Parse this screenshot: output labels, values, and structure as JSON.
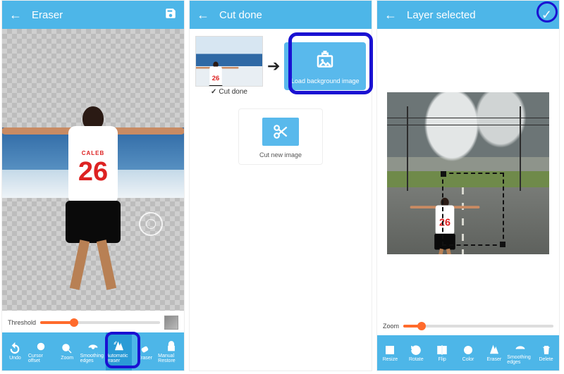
{
  "screen1": {
    "title": "Eraser",
    "threshold_label": "Threshold",
    "jersey_name": "CALEB",
    "jersey_number": "26",
    "tools": {
      "undo": "Undo",
      "cursor_offset": "Cursor offset",
      "zoom": "Zoom",
      "smoothing_edges": "Smoothing edges",
      "automatic_eraser": "Automatic eraser",
      "eraser": "Eraser",
      "manual_restore": "Manual Restore"
    }
  },
  "screen2": {
    "title": "Cut done",
    "cut_done": "Cut done",
    "load_bg": "Load background image",
    "cut_new": "Cut new image"
  },
  "screen3": {
    "title": "Layer selected",
    "zoom_label": "Zoom",
    "jersey_number": "26",
    "tools": {
      "resize": "Resize",
      "rotate": "Rotate",
      "flip": "Flip",
      "color": "Color",
      "eraser": "Eraser",
      "smoothing_edges": "Smoothing edges",
      "delete": "Delete"
    }
  }
}
